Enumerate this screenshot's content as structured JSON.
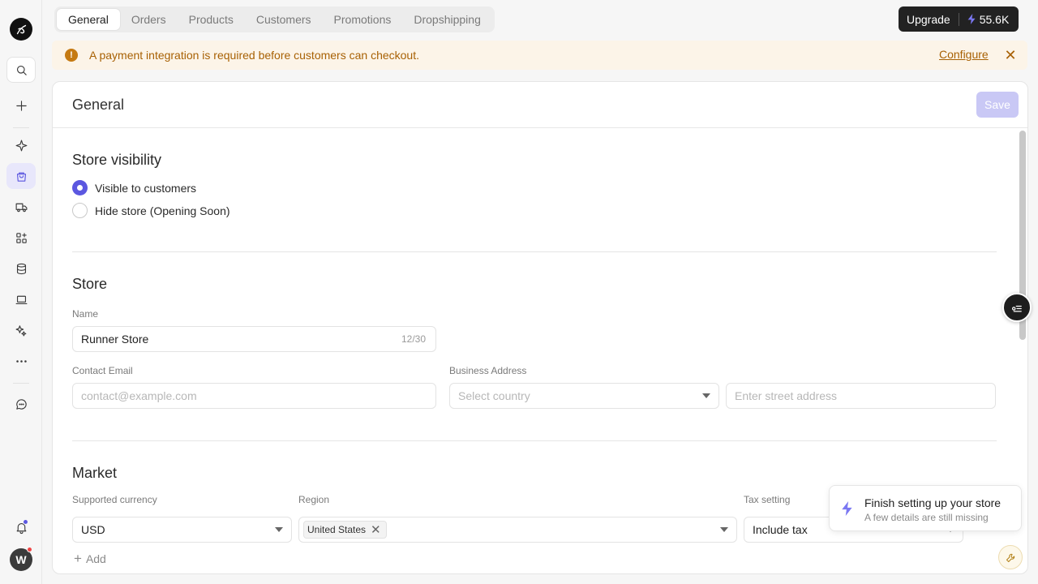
{
  "app": {
    "workspace_initial": "W"
  },
  "tabs": [
    "General",
    "Orders",
    "Products",
    "Customers",
    "Promotions",
    "Dropshipping"
  ],
  "upgrade": {
    "label": "Upgrade",
    "credits": "55.6K"
  },
  "banner": {
    "message": "A payment integration is required before customers can checkout.",
    "action": "Configure",
    "icon": "warning-icon",
    "color": "#a86104"
  },
  "page": {
    "title": "General",
    "save_label": "Save"
  },
  "visibility": {
    "heading": "Store visibility",
    "options": [
      {
        "label": "Visible to customers",
        "selected": true
      },
      {
        "label": "Hide store (Opening Soon)",
        "selected": false
      }
    ]
  },
  "store": {
    "heading": "Store",
    "name_label": "Name",
    "name_value": "Runner Store",
    "name_count": "12/30",
    "email_label": "Contact Email",
    "email_placeholder": "contact@example.com",
    "address_label": "Business Address",
    "country_placeholder": "Select country",
    "street_placeholder": "Enter street address"
  },
  "market": {
    "heading": "Market",
    "currency_label": "Supported currency",
    "currency_value": "USD",
    "region_label": "Region",
    "region_chip": "United States",
    "tax_label": "Tax setting",
    "tax_value": "Include tax",
    "add_label": "Add"
  },
  "toast": {
    "title": "Finish setting up your store",
    "subtitle": "A few details are still missing"
  },
  "colors": {
    "accent": "#5b57e0",
    "warning": "#c57a12",
    "dark": "#222222"
  }
}
